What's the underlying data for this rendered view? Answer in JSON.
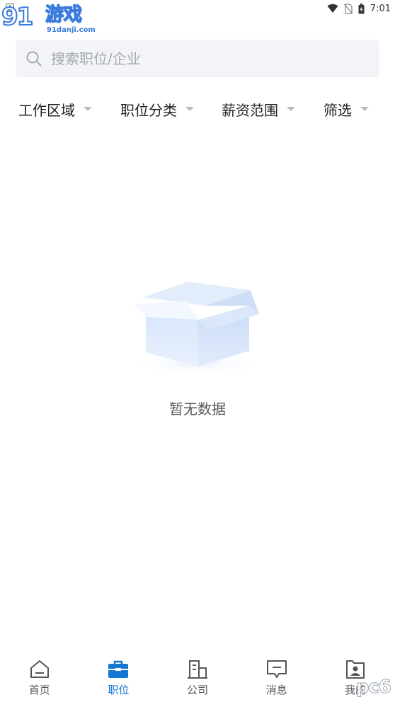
{
  "status_bar": {
    "time": "7:01"
  },
  "watermark": {
    "big": "91",
    "cn": "游戏",
    "url": "91danji.com"
  },
  "search": {
    "placeholder": "搜索职位/企业"
  },
  "filters": [
    {
      "label": "工作区域"
    },
    {
      "label": "职位分类"
    },
    {
      "label": "薪资范围"
    },
    {
      "label": "筛选"
    }
  ],
  "empty_state": {
    "text": "暂无数据"
  },
  "bottom_nav": {
    "active": "职位",
    "items": [
      {
        "label": "首页",
        "icon": "home-icon"
      },
      {
        "label": "职位",
        "icon": "briefcase-icon"
      },
      {
        "label": "公司",
        "icon": "building-icon"
      },
      {
        "label": "消息",
        "icon": "message-icon"
      },
      {
        "label": "我的",
        "icon": "profile-icon"
      }
    ]
  },
  "colors": {
    "accent": "#1677d2",
    "search_bg": "#f2f4f7",
    "placeholder": "#a6a9ae"
  },
  "corner_mark": "pc6"
}
